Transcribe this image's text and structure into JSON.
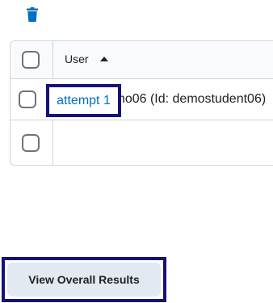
{
  "toolbar": {
    "delete_icon": "trash-icon",
    "delete_color": "#006fbf"
  },
  "grid": {
    "header": {
      "user_label": "User",
      "sort": "ascending"
    },
    "rows": [
      {
        "user": "Student, Demo06 (Id: demostudent06)",
        "checked": false
      }
    ],
    "attempts": [
      {
        "label": "attempt 1",
        "checked": false
      }
    ]
  },
  "footer": {
    "view_results_label": "View Overall Results"
  },
  "colors": {
    "link": "#006fbf",
    "focus_outline": "#15127a",
    "border": "#cdd5dc",
    "button_bg": "#e3e9f1"
  }
}
